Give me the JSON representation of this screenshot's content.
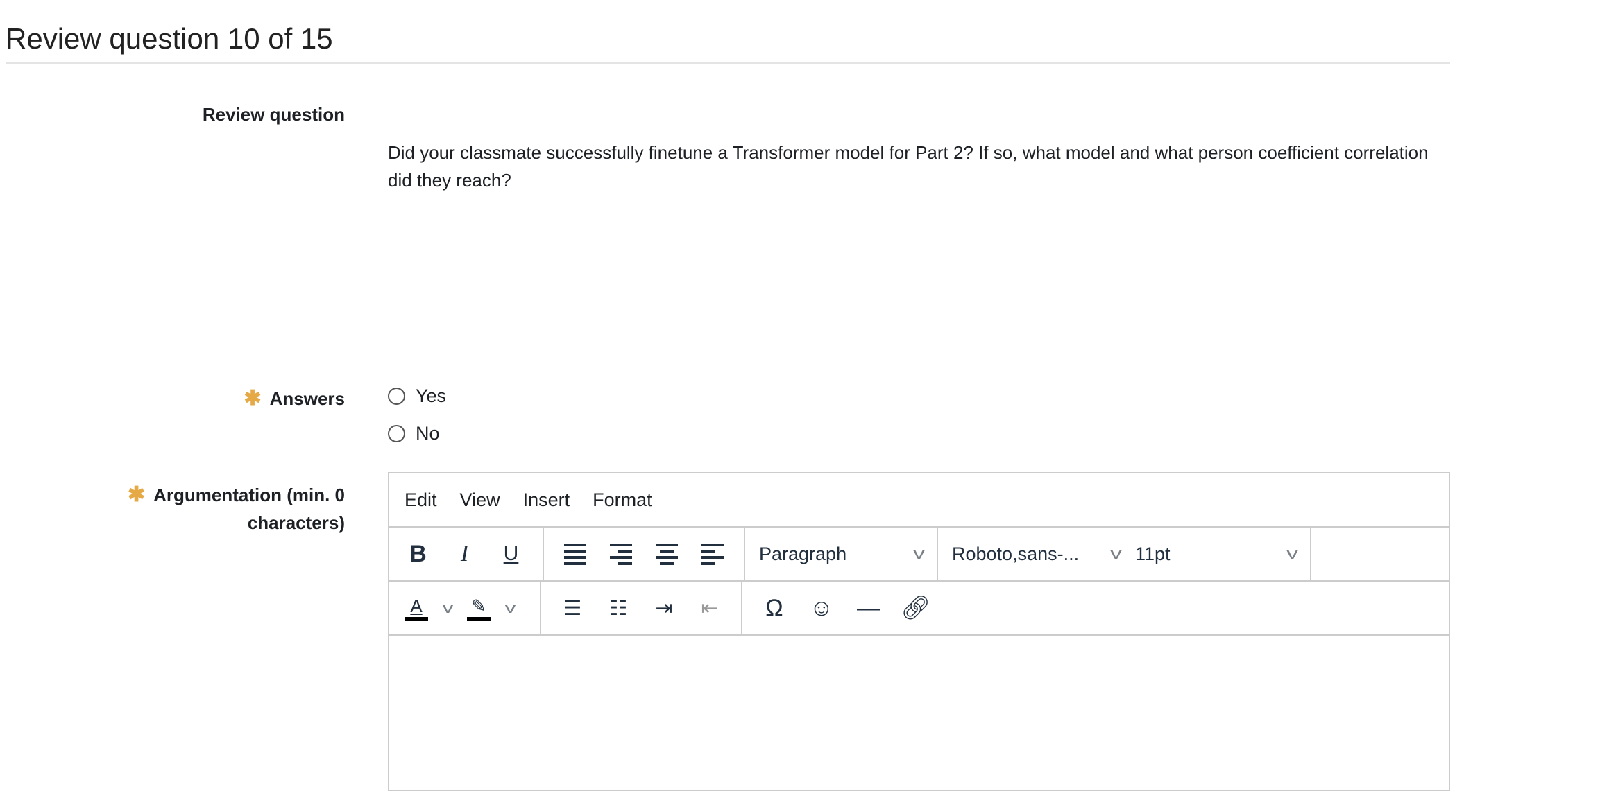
{
  "page_title": "Review question 10 of 15",
  "review_question": {
    "label": "Review question",
    "text": "Did your classmate successfully finetune a Transformer model for Part 2? If so, what model and what person coefficient correlation did they reach?"
  },
  "answers": {
    "label": "Answers",
    "required_mark": "✱",
    "options": [
      {
        "label": "Yes",
        "selected": false
      },
      {
        "label": "No",
        "selected": false
      }
    ]
  },
  "argumentation": {
    "label_line1": "Argumentation (min. 0",
    "label_line2": "characters)",
    "required_mark": "✱",
    "menu": [
      "Edit",
      "View",
      "Insert",
      "Format"
    ],
    "block_format": "Paragraph",
    "font_family": "Roboto,sans-...",
    "font_size": "11pt",
    "content": ""
  },
  "colors": {
    "required": "#e5a946",
    "border": "#cccccc",
    "icon": "#222f3e"
  }
}
